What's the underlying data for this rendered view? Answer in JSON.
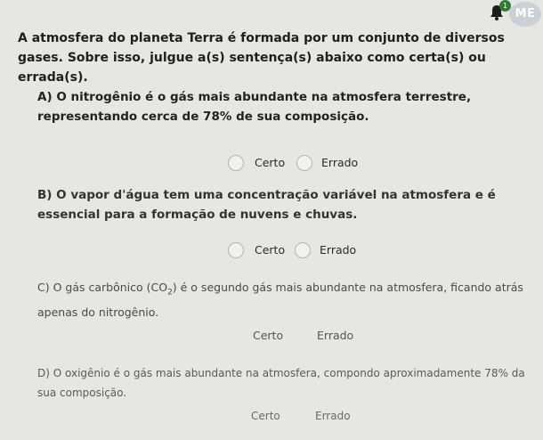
{
  "header": {
    "notification_count": "1",
    "avatar_initials": "ME"
  },
  "intro": "A atmosfera do planeta Terra é formada por um conjunto de diversos gases. Sobre isso, julgue a(s) sentença(s) abaixo como certa(s) ou errada(s).",
  "questions": [
    {
      "text": "A) O nitrogênio é o gás mais abundante na atmosfera terrestre, representando cerca de 78% de sua composição.",
      "option_true": "Certo",
      "option_false": "Errado"
    },
    {
      "text": "B) O vapor d'água tem uma concentração variável na atmosfera e é essencial para a formação de nuvens e chuvas.",
      "option_true": "Certo",
      "option_false": "Errado"
    },
    {
      "text_before": "C) O gás carbônico (CO",
      "subscript": "2",
      "text_after": ") é o segundo gás mais abundante na atmosfera, ficando atrás apenas do nitrogênio.",
      "option_true": "Certo",
      "option_false": "Errado"
    },
    {
      "text": "D) O oxigênio é o gás mais abundante na atmosfera, compondo aproximadamente 78% da sua composição.",
      "option_true": "Certo",
      "option_false": "Errado"
    }
  ]
}
